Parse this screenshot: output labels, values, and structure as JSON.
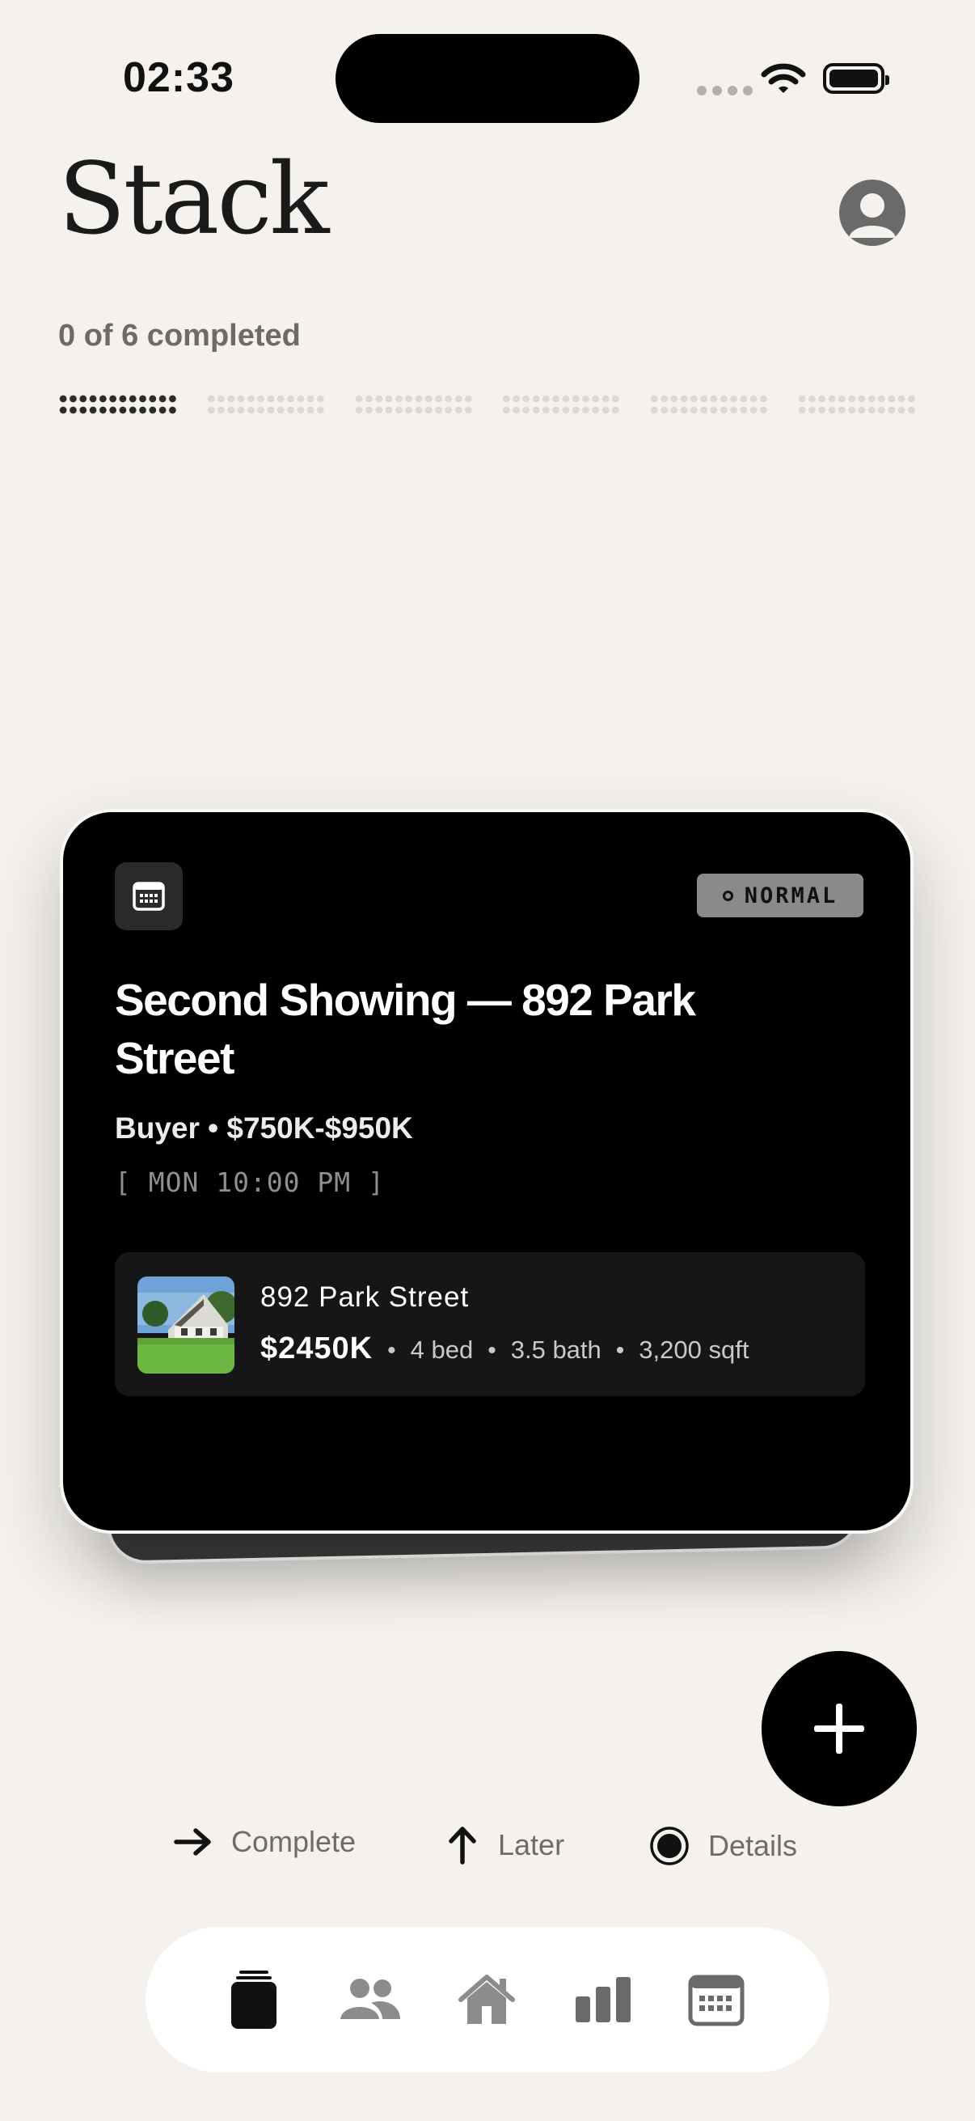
{
  "status": {
    "time": "02:33"
  },
  "header": {
    "title": "Stack",
    "progress_text": "0 of 6 completed"
  },
  "progress": {
    "completed": 0,
    "total": 6,
    "current_index": 0
  },
  "card": {
    "priority": "NORMAL",
    "title": "Second Showing — 892 Park Street",
    "subtitle": "Buyer • $750K-$950K",
    "time": "[ MON 10:00 PM ]",
    "property": {
      "name": "892 Park Street",
      "price": "$2450K",
      "beds": "4 bed",
      "baths": "3.5 bath",
      "sqft": "3,200 sqft",
      "separator": "•"
    }
  },
  "hints": {
    "complete": "Complete",
    "later": "Later",
    "details": "Details"
  },
  "tabs": [
    {
      "name": "stack",
      "icon": "stack-icon",
      "active": true
    },
    {
      "name": "people",
      "icon": "people-icon",
      "active": false
    },
    {
      "name": "home",
      "icon": "house-icon",
      "active": false
    },
    {
      "name": "stats",
      "icon": "bar-chart-icon",
      "active": false
    },
    {
      "name": "calendar",
      "icon": "calendar-icon",
      "active": false
    }
  ],
  "colors": {
    "background": "#f5f2ed",
    "card": "#000000",
    "priority_badge": "#8a8a8a",
    "fab": "#000000",
    "tab_active": "#111111",
    "tab_inactive": "#8c8c8c"
  }
}
